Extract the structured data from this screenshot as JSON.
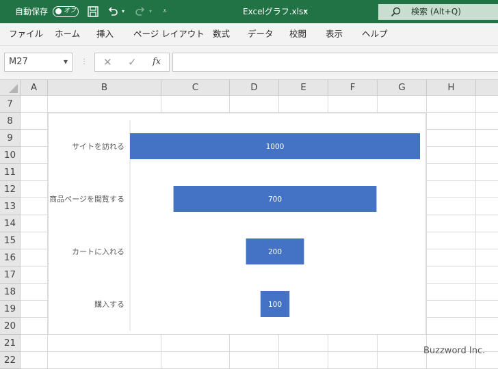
{
  "titlebar": {
    "autosave_label": "自動保存",
    "autosave_state": "オフ",
    "filename": "Excelグラフ.xlsx",
    "search_placeholder": "検索 (Alt+Q)"
  },
  "menu": [
    "ファイル",
    "ホーム",
    "挿入",
    "ページ レイアウト",
    "数式",
    "データ",
    "校閲",
    "表示",
    "ヘルプ"
  ],
  "formula_bar": {
    "name_box": "M27",
    "cancel_glyph": "✕",
    "enter_glyph": "✓",
    "fx_glyph": "fx",
    "content": ""
  },
  "columns": [
    "A",
    "B",
    "C",
    "D",
    "E",
    "F",
    "G",
    "H"
  ],
  "rows": [
    "7",
    "8",
    "9",
    "10",
    "11",
    "12",
    "13",
    "14",
    "15",
    "16",
    "17",
    "18",
    "19",
    "20",
    "21",
    "22"
  ],
  "chart_data": {
    "type": "bar",
    "orientation": "horizontal",
    "style": "funnel",
    "categories": [
      "サイトを訪れる",
      "商品ページを閲覧する",
      "カートに入れる",
      "購入する"
    ],
    "values": [
      1000,
      700,
      200,
      100
    ],
    "data_labels": [
      "1000",
      "700",
      "200",
      "100"
    ],
    "bar_color": "#4472c4",
    "title": "",
    "grid": false
  },
  "watermark": "Buzzword Inc.",
  "colors": {
    "titlebar": "#217346",
    "bar": "#4472c4"
  }
}
